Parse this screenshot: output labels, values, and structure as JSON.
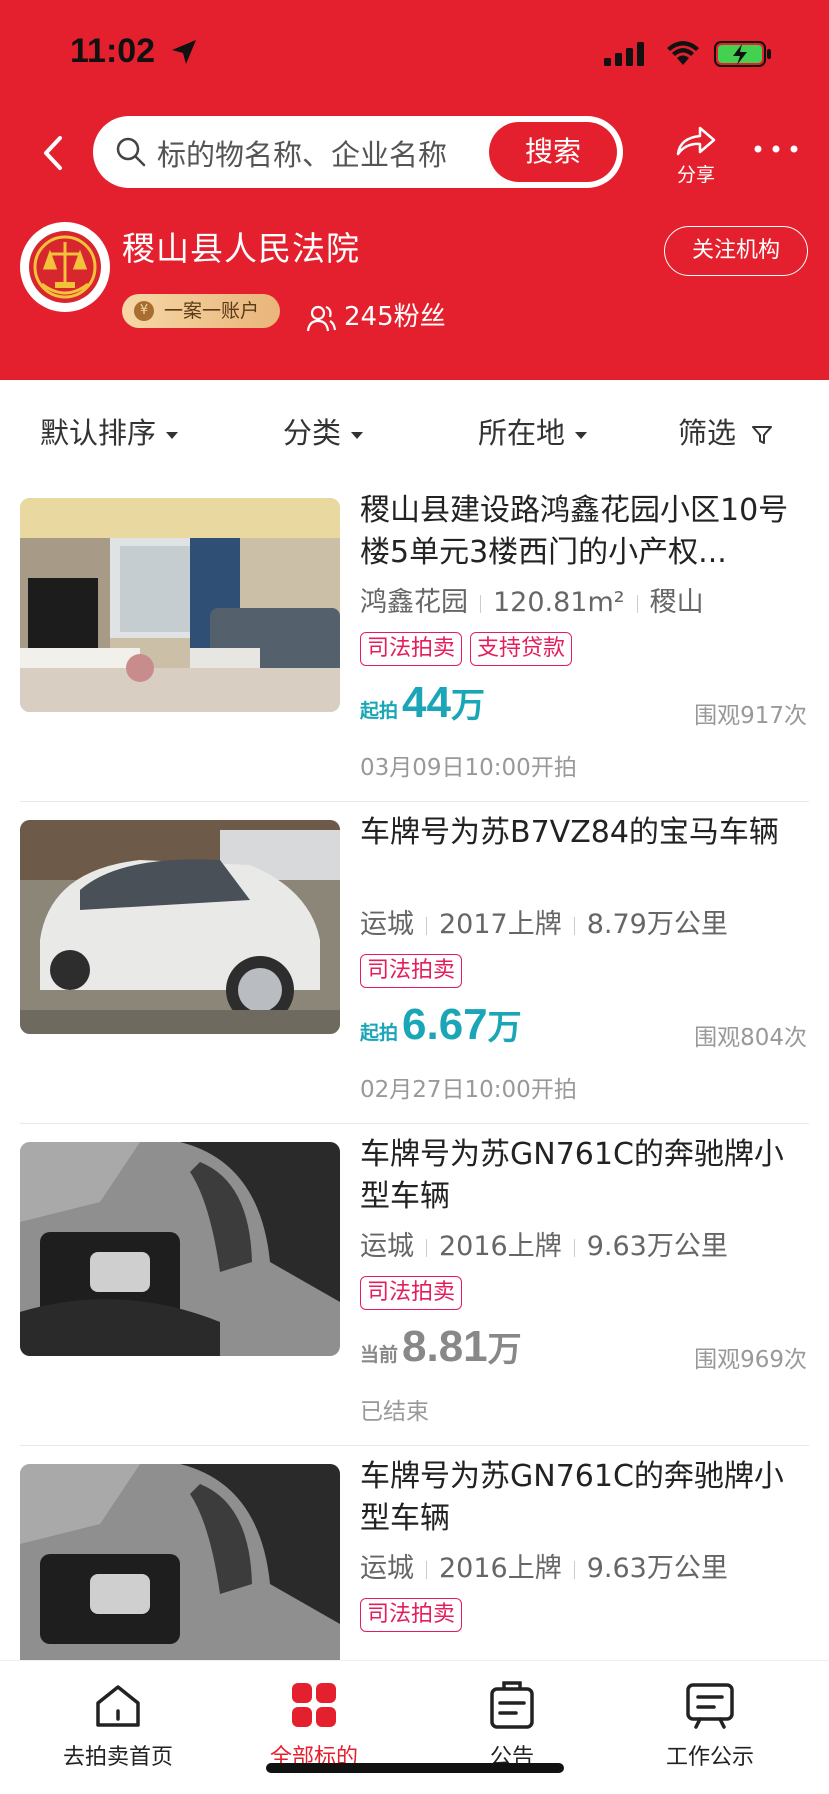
{
  "status_bar": {
    "time": "11:02"
  },
  "search": {
    "placeholder": "标的物名称、企业名称",
    "button": "搜索"
  },
  "share": {
    "label": "分享"
  },
  "court": {
    "name": "稷山县人民法院",
    "follow": "关注机构",
    "badge": "一案一账户",
    "badge_coin": "¥",
    "fans": "245粉丝"
  },
  "filters": [
    {
      "label": "默认排序"
    },
    {
      "label": "分类"
    },
    {
      "label": "所在地"
    },
    {
      "label": "筛选"
    }
  ],
  "items": [
    {
      "title": "稷山县建设路鸿鑫花园小区10号楼5单元3楼西门的小产权...",
      "meta": [
        "鸿鑫花园",
        "120.81m²",
        "稷山"
      ],
      "tags": [
        "司法拍卖",
        "支持贷款"
      ],
      "price_label": "起拍",
      "price_value": "44",
      "price_unit": "万",
      "views": "围观917次",
      "time": "03月09日10:00开拍",
      "status": "upcoming",
      "thumb": "room-photo"
    },
    {
      "title": "车牌号为苏B7VZ84的宝马车辆",
      "meta": [
        "运城",
        "2017上牌",
        "8.79万公里"
      ],
      "tags": [
        "司法拍卖"
      ],
      "price_label": "起拍",
      "price_value": "6.67",
      "price_unit": "万",
      "views": "围观804次",
      "time": "02月27日10:00开拍",
      "status": "upcoming",
      "thumb": "car-photo"
    },
    {
      "title": "车牌号为苏GN761C的奔驰牌小型车辆",
      "meta": [
        "运城",
        "2016上牌",
        "9.63万公里"
      ],
      "tags": [
        "司法拍卖"
      ],
      "price_label": "当前",
      "price_value": "8.81",
      "price_unit": "万",
      "views": "围观969次",
      "time": "已结束",
      "status": "ended",
      "thumb": "interior-photo"
    },
    {
      "title": "车牌号为苏GN761C的奔驰牌小型车辆",
      "meta": [
        "运城",
        "2016上牌",
        "9.63万公里"
      ],
      "tags": [
        "司法拍卖"
      ],
      "thumb": "interior-photo"
    }
  ],
  "bottom_nav": [
    {
      "label": "去拍卖首页",
      "icon": "home-icon"
    },
    {
      "label": "全部标的",
      "icon": "grid-icon",
      "active": true
    },
    {
      "label": "公告",
      "icon": "notice-icon"
    },
    {
      "label": "工作公示",
      "icon": "board-icon"
    }
  ],
  "colors": {
    "brand_red": "#e5202e",
    "price_teal": "#1aa6b7",
    "tag_pink": "#e51d5c"
  }
}
